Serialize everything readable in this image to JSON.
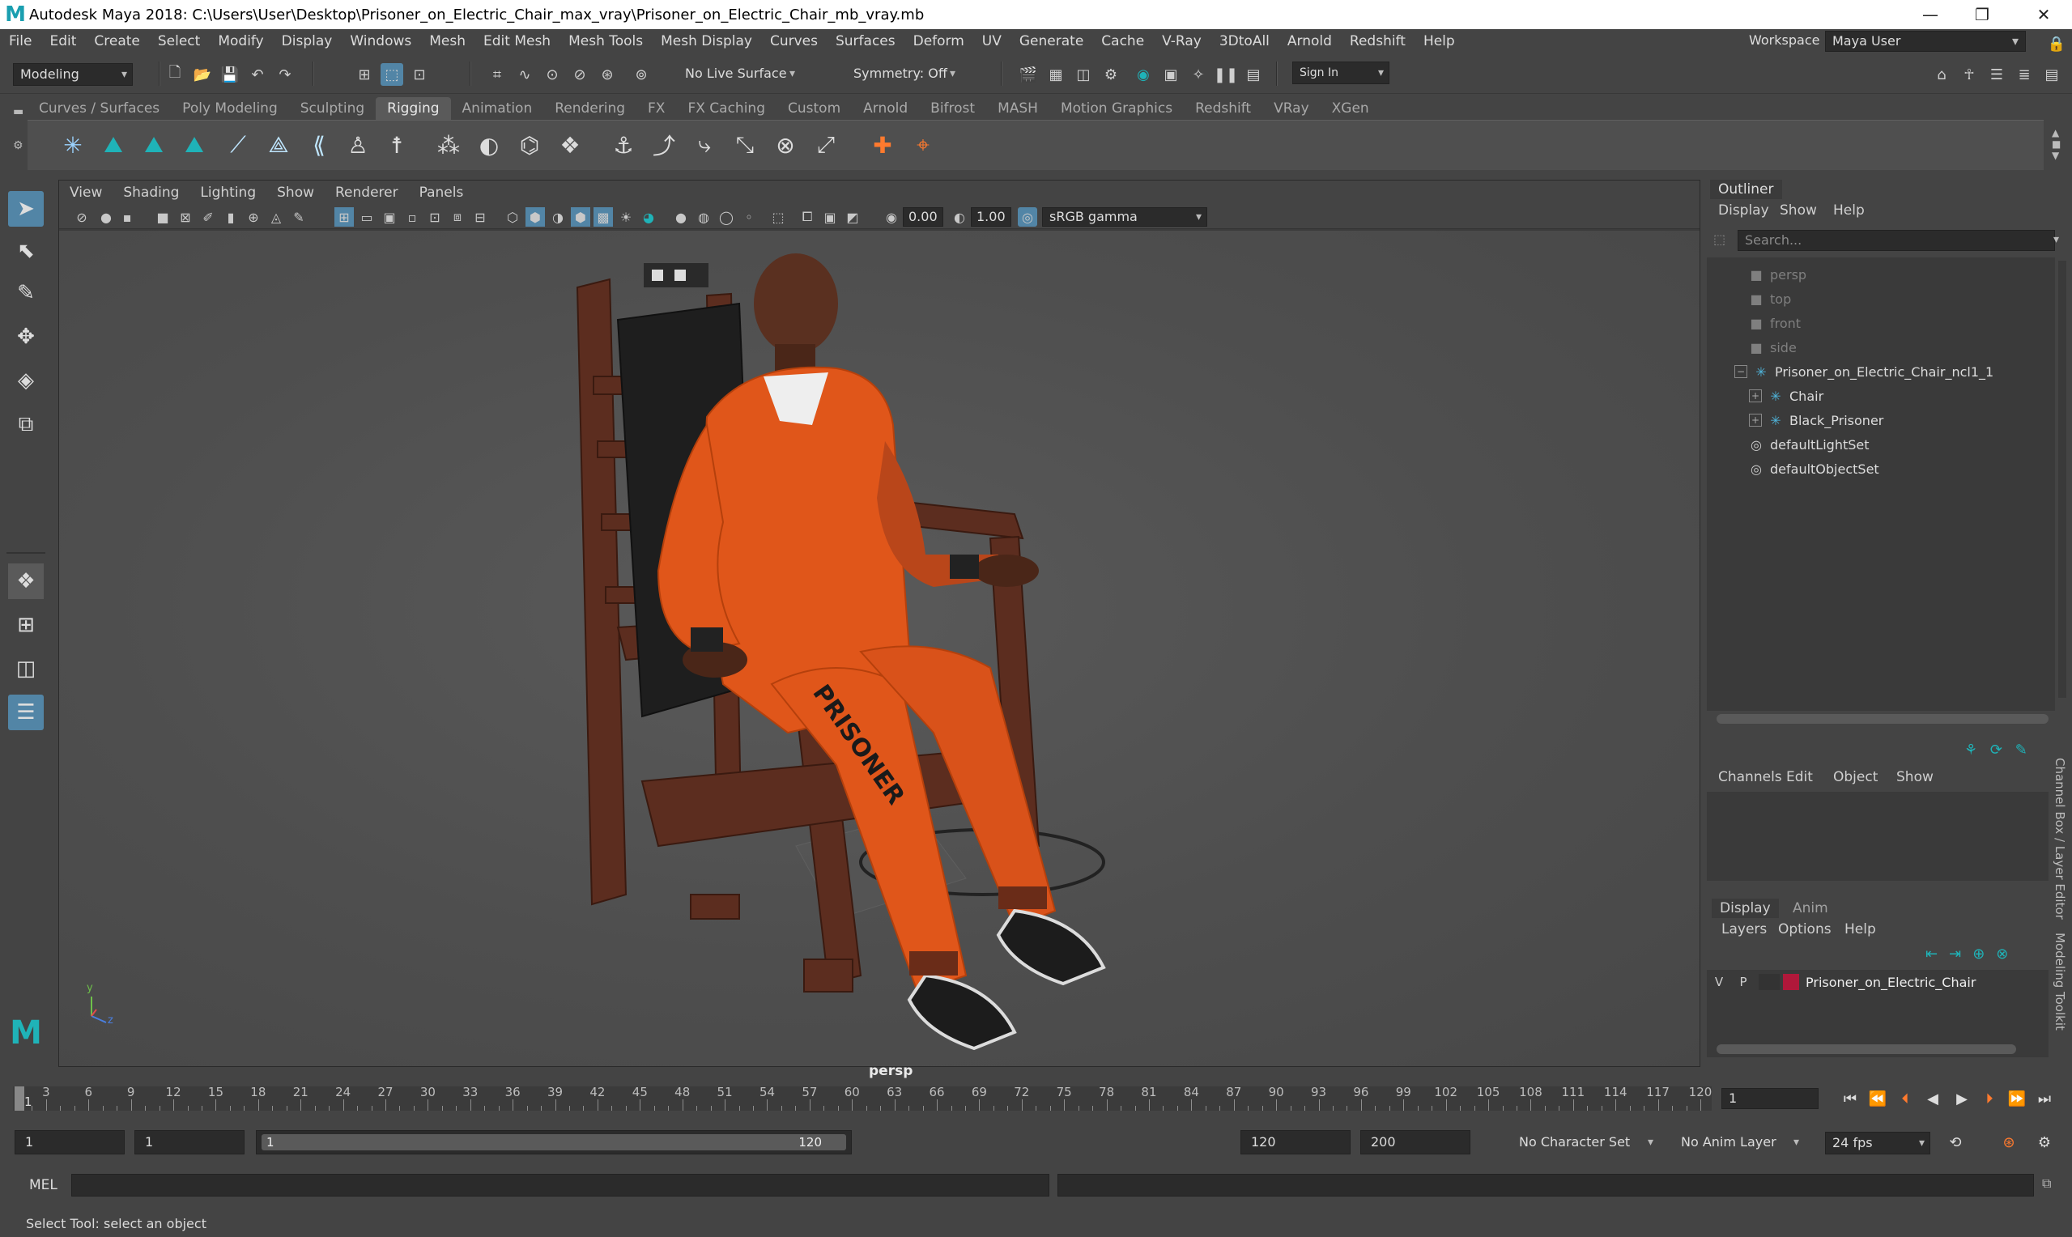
{
  "window": {
    "title": "Autodesk Maya 2018: C:\\Users\\User\\Desktop\\Prisoner_on_Electric_Chair_max_vray\\Prisoner_on_Electric_Chair_mb_vray.mb",
    "logo": "M"
  },
  "menubar": [
    "File",
    "Edit",
    "Create",
    "Select",
    "Modify",
    "Display",
    "Windows",
    "Mesh",
    "Edit Mesh",
    "Mesh Tools",
    "Mesh Display",
    "Curves",
    "Surfaces",
    "Deform",
    "UV",
    "Generate",
    "Cache",
    "V-Ray",
    "3DtoAll",
    "Arnold",
    "Redshift",
    "Help"
  ],
  "workspace": {
    "label": "Workspace :",
    "value": "Maya User"
  },
  "statusline": {
    "mode": "Modeling",
    "live_surface": "No Live Surface",
    "symmetry": "Symmetry: Off",
    "sign_in": "Sign In"
  },
  "shelf": {
    "tabs": [
      "Curves / Surfaces",
      "Poly Modeling",
      "Sculpting",
      "Rigging",
      "Animation",
      "Rendering",
      "FX",
      "FX Caching",
      "Custom",
      "Arnold",
      "Bifrost",
      "MASH",
      "Motion Graphics",
      "Redshift",
      "VRay",
      "XGen"
    ],
    "active_tab": "Rigging",
    "accent": "#5285a6",
    "icon_color": "#1fb3b8"
  },
  "viewport": {
    "menu": [
      "View",
      "Shading",
      "Lighting",
      "Show",
      "Renderer",
      "Panels"
    ],
    "exposure": "0.00",
    "gamma": "1.00",
    "color_space": "sRGB gamma",
    "camera": "persp",
    "axis": {
      "y": "y",
      "z": "z"
    }
  },
  "outliner": {
    "title": "Outliner",
    "menu": [
      "Display",
      "Show",
      "Help"
    ],
    "search_placeholder": "Search...",
    "items": [
      {
        "label": "persp",
        "icon": "camera-icon",
        "dim": true
      },
      {
        "label": "top",
        "icon": "camera-icon",
        "dim": true
      },
      {
        "label": "front",
        "icon": "camera-icon",
        "dim": true
      },
      {
        "label": "side",
        "icon": "camera-icon",
        "dim": true
      },
      {
        "label": "Prisoner_on_Electric_Chair_ncl1_1",
        "icon": "transform-icon",
        "dim": false
      },
      {
        "label": "Chair",
        "icon": "transform-icon",
        "dim": false
      },
      {
        "label": "Black_Prisoner",
        "icon": "transform-icon",
        "dim": false
      },
      {
        "label": "defaultLightSet",
        "icon": "set-icon",
        "dim": false
      },
      {
        "label": "defaultObjectSet",
        "icon": "set-icon",
        "dim": false
      }
    ]
  },
  "channelbox": {
    "menu": [
      "Channels",
      "Edit",
      "Object",
      "Show"
    ],
    "side_tab": "Channel Box / Layer Editor",
    "side_tab2": "Modeling Toolkit"
  },
  "layereditor": {
    "tabs": [
      "Display",
      "Anim"
    ],
    "menu": [
      "Layers",
      "Options",
      "Help"
    ],
    "layer": {
      "v": "V",
      "p": "P",
      "name": "Prisoner_on_Electric_Chair",
      "color": "#b0183a"
    }
  },
  "timeline": {
    "ticks": [
      "3",
      "6",
      "9",
      "12",
      "15",
      "18",
      "21",
      "24",
      "27",
      "30",
      "33",
      "36",
      "39",
      "42",
      "45",
      "48",
      "51",
      "54",
      "57",
      "60",
      "63",
      "66",
      "69",
      "72",
      "75",
      "78",
      "81",
      "84",
      "87",
      "90",
      "93",
      "96",
      "99",
      "102",
      "105",
      "108",
      "111",
      "114",
      "117",
      "120"
    ],
    "start_marker": "1",
    "current_frame": "1"
  },
  "range": {
    "start": "1",
    "playback_start": "1",
    "slider_start": "1",
    "slider_end": "120",
    "playback_end": "120",
    "end": "200",
    "character_set": "No Character Set",
    "anim_layer": "No Anim Layer",
    "fps": "24 fps"
  },
  "cmdline": {
    "label": "MEL"
  },
  "helpline": {
    "text": "Select Tool: select an object"
  }
}
